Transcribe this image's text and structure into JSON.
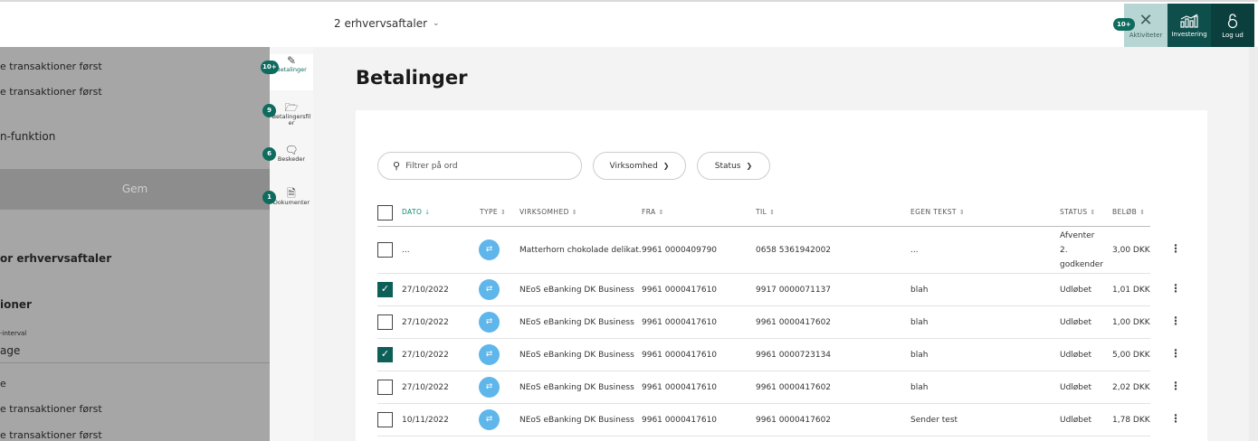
{
  "topbar": {
    "agreement": "2 erhvervsaftaler",
    "activities_badge": "10+",
    "activities_label": "Aktiviteter",
    "investing_label": "Investering",
    "logout_label": "Log ud"
  },
  "left_panel": {
    "line1": "e transaktioner først",
    "line2": "e transaktioner først",
    "line3": "n-funktion",
    "save_label": "Gem",
    "section1": "or erhvervsaftaler",
    "section2": "ioner",
    "interval_label": "-interval",
    "interval_value": "age",
    "line4": "e",
    "line5": "e transaktioner først",
    "line6": "e transaktioner først"
  },
  "rail": [
    {
      "label": "Betalinger",
      "badge": "10+",
      "icon": "pen-icon"
    },
    {
      "label": "Betalingersfil er",
      "badge": "9",
      "icon": "files-icon"
    },
    {
      "label": "Beskeder",
      "badge": "6",
      "icon": "message-icon"
    },
    {
      "label": "Dokumenter",
      "badge": "1",
      "icon": "document-icon"
    }
  ],
  "main": {
    "title": "Betalinger",
    "search_placeholder": "Filtrer på ord",
    "filter_company": "Virksomhed",
    "filter_status": "Status"
  },
  "table": {
    "headers": {
      "date": "DATO",
      "type": "TYPE",
      "company": "VIRKSOMHED",
      "from": "FRA",
      "to": "TIL",
      "own_text": "EGEN TEKST",
      "status": "STATUS",
      "amount": "BELØB"
    },
    "rows": [
      {
        "checked": false,
        "date": "...",
        "company": "Matterhorn chokolade delikat...",
        "from": "9961 0000409790",
        "to": "0658 5361942002",
        "own_text": "...",
        "status_lines": [
          "Afventer",
          "2.",
          "godkender"
        ],
        "amount": "3,00 DKK"
      },
      {
        "checked": true,
        "date": "27/10/2022",
        "company": "NEoS eBanking DK Business",
        "from": "9961 0000417610",
        "to": "9917 0000071137",
        "own_text": "blah",
        "status": "Udløbet",
        "amount": "1,01 DKK"
      },
      {
        "checked": false,
        "date": "27/10/2022",
        "company": "NEoS eBanking DK Business",
        "from": "9961 0000417610",
        "to": "9961 0000417602",
        "own_text": "blah",
        "status": "Udløbet",
        "amount": "1,00 DKK"
      },
      {
        "checked": true,
        "date": "27/10/2022",
        "company": "NEoS eBanking DK Business",
        "from": "9961 0000417610",
        "to": "9961 0000723134",
        "own_text": "blah",
        "status": "Udløbet",
        "amount": "5,00 DKK"
      },
      {
        "checked": false,
        "date": "27/10/2022",
        "company": "NEoS eBanking DK Business",
        "from": "9961 0000417610",
        "to": "9961 0000417602",
        "own_text": "blah",
        "status": "Udløbet",
        "amount": "2,02 DKK"
      },
      {
        "checked": false,
        "date": "10/11/2022",
        "company": "NEoS eBanking DK Business",
        "from": "9961 0000417610",
        "to": "9961 0000417602",
        "own_text": "Sender test",
        "status": "Udløbet",
        "amount": "1,78 DKK"
      }
    ]
  }
}
